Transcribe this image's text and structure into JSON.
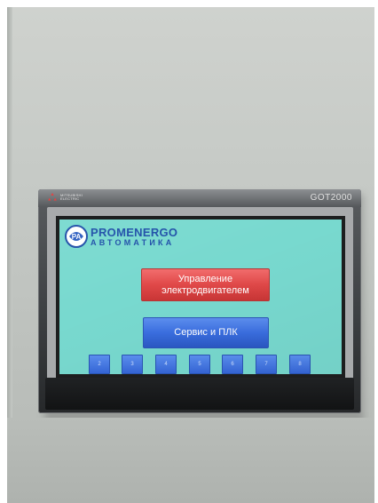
{
  "hmi": {
    "brand_lines": [
      "MITSUBISHI",
      "ELECTRIC"
    ],
    "model": "GOT2000"
  },
  "screen": {
    "logo": {
      "line1": "PROMENERGO",
      "line2": "АВТОМАТИКА",
      "emblem_text": "PA"
    },
    "buttons": {
      "motor_control": "Управление электродвигателем",
      "service_plc": "Сервис и ПЛК"
    },
    "number_buttons": [
      "2",
      "3",
      "4",
      "5",
      "6",
      "7",
      "8"
    ],
    "colors": {
      "background": "#78d9cf",
      "red_button": "#e04848",
      "blue_button": "#3a6ee0",
      "logo_blue": "#1f4fa8"
    }
  }
}
